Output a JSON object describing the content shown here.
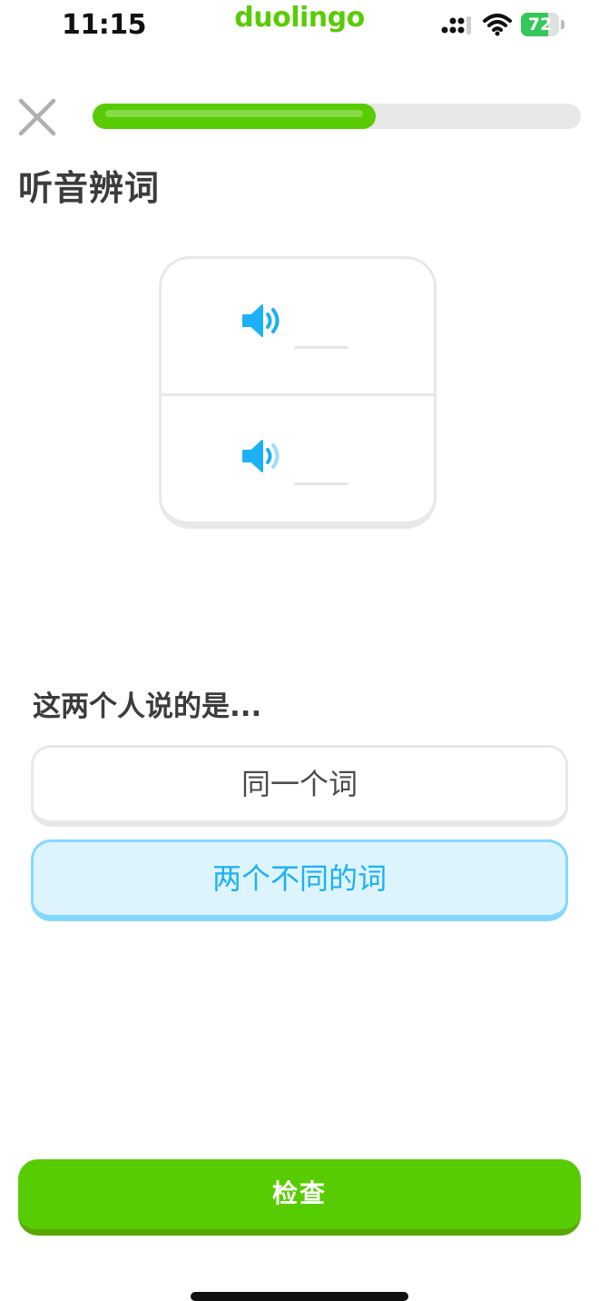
{
  "status_bar": {
    "time": "11:15",
    "app_name": "duolingo",
    "battery_level": "72",
    "battery_fraction": 0.72,
    "battery_color": "#34c759",
    "icons": [
      "signal-icon",
      "wifi-icon",
      "battery-icon"
    ]
  },
  "header": {
    "close_icon": "close-icon",
    "progress_fraction": 0.58,
    "progress_color": "#58cc02"
  },
  "exercise": {
    "title": "听音辨词",
    "audio_clips": [
      {
        "icon": "speaker-icon",
        "color": "#1cb0f6"
      },
      {
        "icon": "speaker-icon",
        "color": "#1cb0f6"
      }
    ],
    "prompt": "这两个人说的是...",
    "options": [
      {
        "label": "同一个词",
        "selected": false
      },
      {
        "label": "两个不同的词",
        "selected": true
      }
    ]
  },
  "footer": {
    "check_label": "检查",
    "button_color": "#58cc02"
  }
}
